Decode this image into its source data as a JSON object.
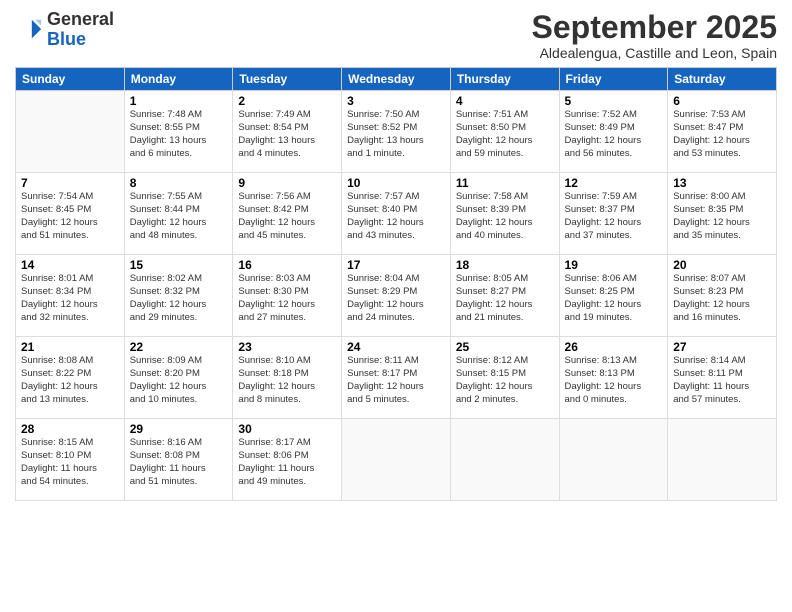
{
  "header": {
    "logo": {
      "general": "General",
      "blue": "Blue"
    },
    "month": "September 2025",
    "location": "Aldealengua, Castille and Leon, Spain"
  },
  "weekdays": [
    "Sunday",
    "Monday",
    "Tuesday",
    "Wednesday",
    "Thursday",
    "Friday",
    "Saturday"
  ],
  "weeks": [
    [
      {
        "day": null,
        "info": null
      },
      {
        "day": "1",
        "info": "Sunrise: 7:48 AM\nSunset: 8:55 PM\nDaylight: 13 hours\nand 6 minutes."
      },
      {
        "day": "2",
        "info": "Sunrise: 7:49 AM\nSunset: 8:54 PM\nDaylight: 13 hours\nand 4 minutes."
      },
      {
        "day": "3",
        "info": "Sunrise: 7:50 AM\nSunset: 8:52 PM\nDaylight: 13 hours\nand 1 minute."
      },
      {
        "day": "4",
        "info": "Sunrise: 7:51 AM\nSunset: 8:50 PM\nDaylight: 12 hours\nand 59 minutes."
      },
      {
        "day": "5",
        "info": "Sunrise: 7:52 AM\nSunset: 8:49 PM\nDaylight: 12 hours\nand 56 minutes."
      },
      {
        "day": "6",
        "info": "Sunrise: 7:53 AM\nSunset: 8:47 PM\nDaylight: 12 hours\nand 53 minutes."
      }
    ],
    [
      {
        "day": "7",
        "info": "Sunrise: 7:54 AM\nSunset: 8:45 PM\nDaylight: 12 hours\nand 51 minutes."
      },
      {
        "day": "8",
        "info": "Sunrise: 7:55 AM\nSunset: 8:44 PM\nDaylight: 12 hours\nand 48 minutes."
      },
      {
        "day": "9",
        "info": "Sunrise: 7:56 AM\nSunset: 8:42 PM\nDaylight: 12 hours\nand 45 minutes."
      },
      {
        "day": "10",
        "info": "Sunrise: 7:57 AM\nSunset: 8:40 PM\nDaylight: 12 hours\nand 43 minutes."
      },
      {
        "day": "11",
        "info": "Sunrise: 7:58 AM\nSunset: 8:39 PM\nDaylight: 12 hours\nand 40 minutes."
      },
      {
        "day": "12",
        "info": "Sunrise: 7:59 AM\nSunset: 8:37 PM\nDaylight: 12 hours\nand 37 minutes."
      },
      {
        "day": "13",
        "info": "Sunrise: 8:00 AM\nSunset: 8:35 PM\nDaylight: 12 hours\nand 35 minutes."
      }
    ],
    [
      {
        "day": "14",
        "info": "Sunrise: 8:01 AM\nSunset: 8:34 PM\nDaylight: 12 hours\nand 32 minutes."
      },
      {
        "day": "15",
        "info": "Sunrise: 8:02 AM\nSunset: 8:32 PM\nDaylight: 12 hours\nand 29 minutes."
      },
      {
        "day": "16",
        "info": "Sunrise: 8:03 AM\nSunset: 8:30 PM\nDaylight: 12 hours\nand 27 minutes."
      },
      {
        "day": "17",
        "info": "Sunrise: 8:04 AM\nSunset: 8:29 PM\nDaylight: 12 hours\nand 24 minutes."
      },
      {
        "day": "18",
        "info": "Sunrise: 8:05 AM\nSunset: 8:27 PM\nDaylight: 12 hours\nand 21 minutes."
      },
      {
        "day": "19",
        "info": "Sunrise: 8:06 AM\nSunset: 8:25 PM\nDaylight: 12 hours\nand 19 minutes."
      },
      {
        "day": "20",
        "info": "Sunrise: 8:07 AM\nSunset: 8:23 PM\nDaylight: 12 hours\nand 16 minutes."
      }
    ],
    [
      {
        "day": "21",
        "info": "Sunrise: 8:08 AM\nSunset: 8:22 PM\nDaylight: 12 hours\nand 13 minutes."
      },
      {
        "day": "22",
        "info": "Sunrise: 8:09 AM\nSunset: 8:20 PM\nDaylight: 12 hours\nand 10 minutes."
      },
      {
        "day": "23",
        "info": "Sunrise: 8:10 AM\nSunset: 8:18 PM\nDaylight: 12 hours\nand 8 minutes."
      },
      {
        "day": "24",
        "info": "Sunrise: 8:11 AM\nSunset: 8:17 PM\nDaylight: 12 hours\nand 5 minutes."
      },
      {
        "day": "25",
        "info": "Sunrise: 8:12 AM\nSunset: 8:15 PM\nDaylight: 12 hours\nand 2 minutes."
      },
      {
        "day": "26",
        "info": "Sunrise: 8:13 AM\nSunset: 8:13 PM\nDaylight: 12 hours\nand 0 minutes."
      },
      {
        "day": "27",
        "info": "Sunrise: 8:14 AM\nSunset: 8:11 PM\nDaylight: 11 hours\nand 57 minutes."
      }
    ],
    [
      {
        "day": "28",
        "info": "Sunrise: 8:15 AM\nSunset: 8:10 PM\nDaylight: 11 hours\nand 54 minutes."
      },
      {
        "day": "29",
        "info": "Sunrise: 8:16 AM\nSunset: 8:08 PM\nDaylight: 11 hours\nand 51 minutes."
      },
      {
        "day": "30",
        "info": "Sunrise: 8:17 AM\nSunset: 8:06 PM\nDaylight: 11 hours\nand 49 minutes."
      },
      {
        "day": null,
        "info": null
      },
      {
        "day": null,
        "info": null
      },
      {
        "day": null,
        "info": null
      },
      {
        "day": null,
        "info": null
      }
    ]
  ]
}
